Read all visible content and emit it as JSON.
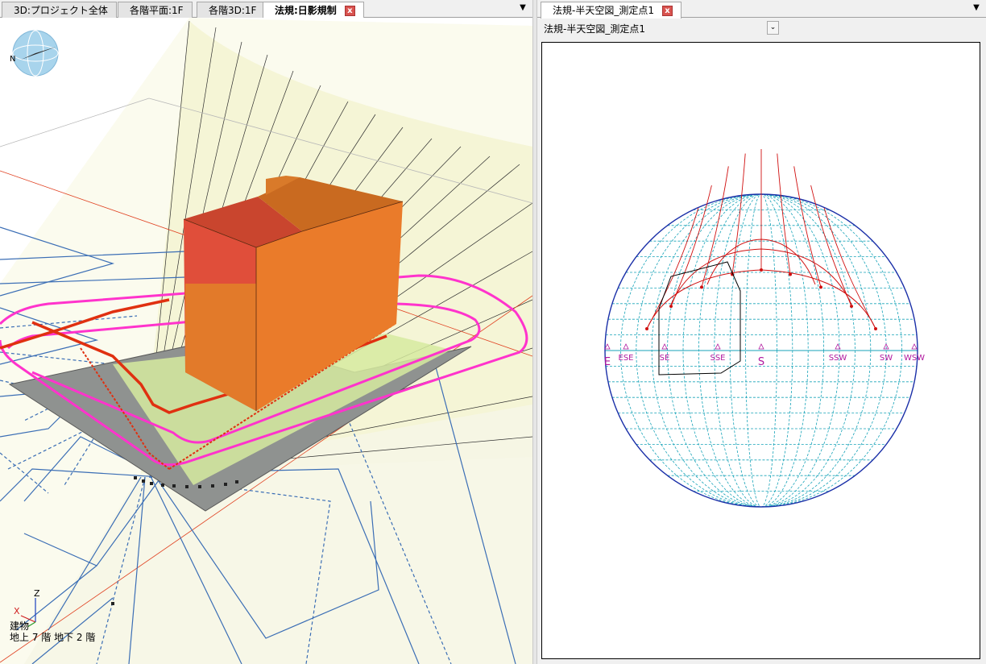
{
  "left_tabs": [
    {
      "label": "3D:プロジェクト全体"
    },
    {
      "label": "各階平面:1F"
    },
    {
      "label": "各階3D:1F"
    },
    {
      "label": "法規:日影規制"
    }
  ],
  "right_tabs": [
    {
      "label": "法規-半天空図_測定点1"
    }
  ],
  "close_glyph": "x",
  "menu_glyph": "▼",
  "dropdown": {
    "value": "法規-半天空図_測定点1",
    "arrow": "⌄"
  },
  "compass": {
    "north_label": "N",
    "icon": "compass-icon"
  },
  "axes": {
    "x": "X",
    "z": "Z"
  },
  "info": {
    "line1": "建物",
    "line2": "地上 7 階  地下 2 階"
  },
  "sky": {
    "directions": [
      "E",
      "ESE",
      "SE",
      "SSE",
      "S",
      "SSW",
      "SW",
      "WSW"
    ]
  },
  "colors": {
    "building_top": "#d9573a",
    "building_face": "#e87a2a",
    "shadow_boundary": "#ff33cc",
    "shadow_line": "#e03010",
    "sky_grid": "#17a3b8",
    "sky_outline": "#1a2fa8",
    "sun_path": "#d01010",
    "direction_label": "#b0179e"
  }
}
